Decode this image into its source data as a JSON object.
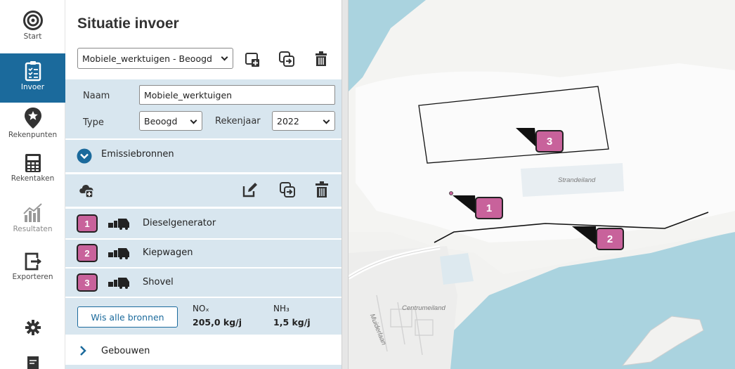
{
  "nav": {
    "start": "Start",
    "invoer": "Invoer",
    "rekenpunten": "Rekenpunten",
    "rekentaken": "Rekentaken",
    "resultaten": "Resultaten",
    "exporteren": "Exporteren"
  },
  "panel": {
    "title": "Situatie invoer",
    "situation_select": "Mobiele_werktuigen - Beoogd",
    "naam_label": "Naam",
    "naam_value": "Mobiele_werktuigen",
    "type_label": "Type",
    "type_value": "Beoogd",
    "rekenjaar_label": "Rekenjaar",
    "rekenjaar_value": "2022",
    "emissie_label": "Emissiebronnen",
    "sources": [
      {
        "number": "1",
        "name": "Dieselgenerator"
      },
      {
        "number": "2",
        "name": "Kiepwagen"
      },
      {
        "number": "3",
        "name": "Shovel"
      }
    ],
    "clear_button": "Wis alle bronnen",
    "nox_label": "NOₓ",
    "nox_value": "205,0 kg/j",
    "nh3_label": "NH₃",
    "nh3_value": "1,5 kg/j",
    "gebouwen_label": "Gebouwen"
  },
  "map": {
    "label_strandeiland": "Strandeiland",
    "label_centrumeiland": "Centrumeiland",
    "label_muiderlaan": "Muiderlaan",
    "markers": [
      "1",
      "2",
      "3"
    ]
  },
  "colors": {
    "accent": "#1b6a9c",
    "badge": "#c8629b",
    "band": "#d8e6ef",
    "water": "#aad3df"
  }
}
